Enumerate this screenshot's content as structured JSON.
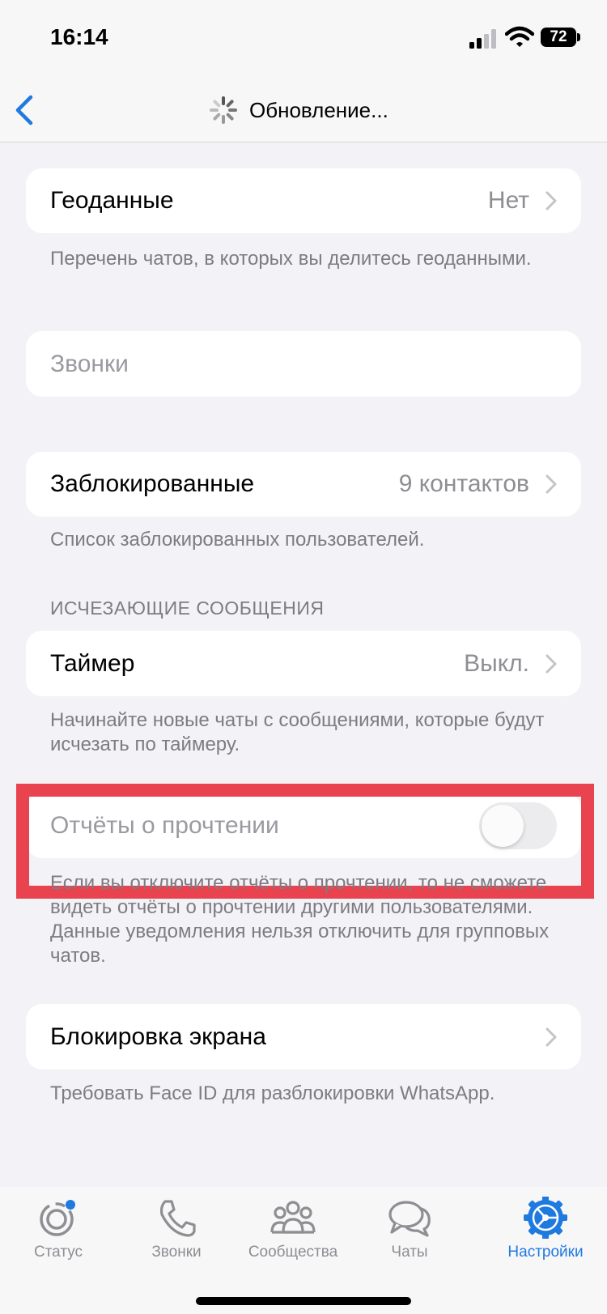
{
  "status_bar": {
    "time": "16:14",
    "battery": "72"
  },
  "nav": {
    "title": "Обновление..."
  },
  "geodata": {
    "label": "Геоданные",
    "value": "Нет",
    "footnote": "Перечень чатов, в которых вы делитесь геоданными."
  },
  "calls": {
    "label": "Звонки"
  },
  "blocked": {
    "label": "Заблокированные",
    "value": "9 контактов",
    "footnote": "Список заблокированных пользователей."
  },
  "disappearing": {
    "header": "ИСЧЕЗАЮЩИЕ СООБЩЕНИЯ",
    "timer_label": "Таймер",
    "timer_value": "Выкл.",
    "footnote": "Начинайте новые чаты с сообщениями, которые будут исчезать по таймеру."
  },
  "read_receipts": {
    "label": "Отчёты о прочтении",
    "enabled": false,
    "footnote": "Если вы отключите отчёты о прочтении, то не сможете видеть отчёты о прочтении другими пользователями. Данные уведомления нельзя отключить для групповых чатов."
  },
  "screen_lock": {
    "label": "Блокировка экрана",
    "footnote": "Требовать Face ID для разблокировки WhatsApp."
  },
  "tabs": [
    {
      "label": "Статус",
      "icon": "status-icon"
    },
    {
      "label": "Звонки",
      "icon": "phone-icon"
    },
    {
      "label": "Сообщества",
      "icon": "communities-icon"
    },
    {
      "label": "Чаты",
      "icon": "chats-icon"
    },
    {
      "label": "Настройки",
      "icon": "settings-gear-icon",
      "active": true
    }
  ],
  "colors": {
    "accent": "#1f7ae0",
    "highlight": "#e8434e",
    "background": "#f2f2f7"
  }
}
